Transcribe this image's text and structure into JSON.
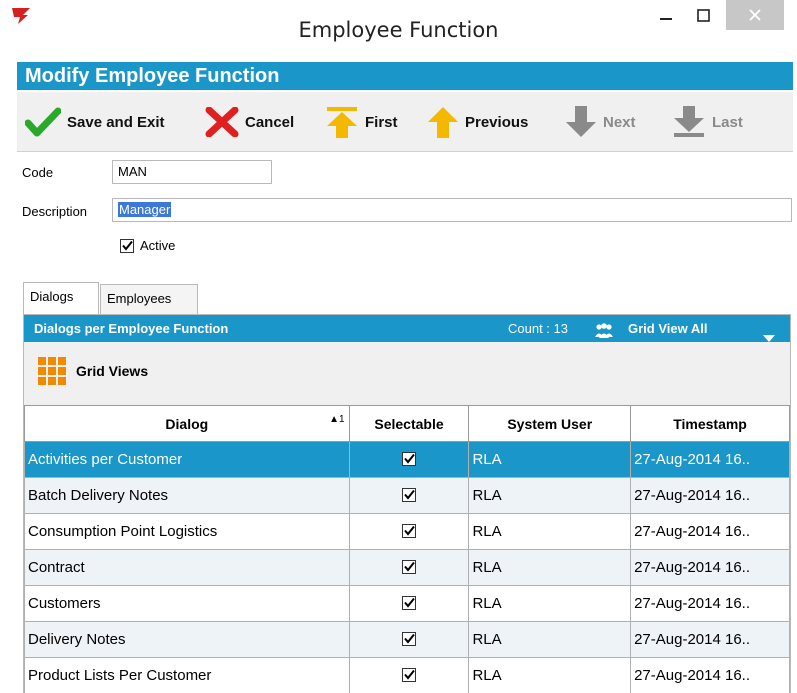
{
  "window": {
    "title": "Employee Function",
    "minimize_glyph": "–",
    "maximize_glyph": "☐",
    "close_glyph": "✕",
    "icon": "app-logo-icon"
  },
  "header": {
    "title": "Modify Employee Function"
  },
  "toolbar": {
    "save_label": "Save and Exit",
    "cancel_label": "Cancel",
    "first_label": "First",
    "previous_label": "Previous",
    "next_label": "Next",
    "last_label": "Last",
    "next_disabled": true,
    "last_disabled": true
  },
  "form": {
    "code_label": "Code",
    "code_value": "MAN",
    "description_label": "Description",
    "description_value": "Manager",
    "active_label": "Active",
    "active_checked": true
  },
  "tabs": [
    {
      "label": "Dialogs",
      "active": true
    },
    {
      "label": "Employees",
      "active": false
    }
  ],
  "panel": {
    "title": "Dialogs per Employee Function",
    "count_text": "Count : 13",
    "grid_view_all": "Grid View All",
    "grid_views_label": "Grid Views"
  },
  "table": {
    "columns": [
      "Dialog",
      "Selectable",
      "System User",
      "Timestamp"
    ],
    "sort_indicator": "1",
    "rows": [
      {
        "dialog": "Activities per Customer",
        "selectable": true,
        "system_user": "RLA",
        "timestamp": "27-Aug-2014 16.."
      },
      {
        "dialog": "Batch Delivery Notes",
        "selectable": true,
        "system_user": "RLA",
        "timestamp": "27-Aug-2014 16.."
      },
      {
        "dialog": "Consumption Point Logistics",
        "selectable": true,
        "system_user": "RLA",
        "timestamp": "27-Aug-2014 16.."
      },
      {
        "dialog": "Contract",
        "selectable": true,
        "system_user": "RLA",
        "timestamp": "27-Aug-2014 16.."
      },
      {
        "dialog": "Customers",
        "selectable": true,
        "system_user": "RLA",
        "timestamp": "27-Aug-2014 16.."
      },
      {
        "dialog": "Delivery Notes",
        "selectable": true,
        "system_user": "RLA",
        "timestamp": "27-Aug-2014 16.."
      },
      {
        "dialog": "Product Lists Per Customer",
        "selectable": true,
        "system_user": "RLA",
        "timestamp": "27-Aug-2014 16.."
      }
    ]
  },
  "colors": {
    "accent": "#1a96c8",
    "save_green": "#2aa82a",
    "cancel_red": "#e02020",
    "nav_yellow": "#f5b800",
    "disabled_gray": "#8a8a8a"
  }
}
